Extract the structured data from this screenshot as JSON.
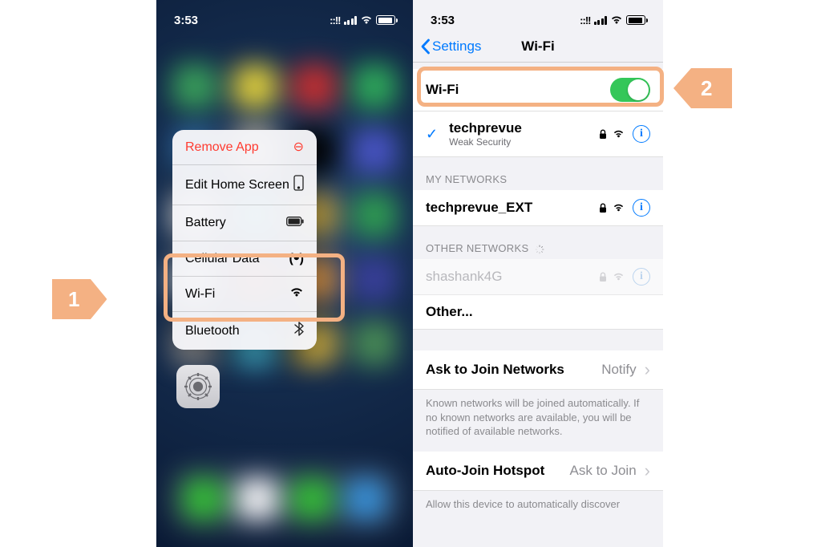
{
  "status_time": "3:53",
  "left": {
    "menu": {
      "remove": "Remove App",
      "edit_home": "Edit Home Screen",
      "battery": "Battery",
      "cellular": "Cellular Data",
      "wifi": "Wi-Fi",
      "bluetooth": "Bluetooth"
    }
  },
  "right": {
    "back": "Settings",
    "title": "Wi-Fi",
    "wifi_label": "Wi-Fi",
    "connected": {
      "ssid": "techprevue",
      "security": "Weak Security"
    },
    "my_networks_header": "MY NETWORKS",
    "my_networks": [
      {
        "ssid": "techprevue_EXT"
      }
    ],
    "other_networks_header": "OTHER NETWORKS",
    "other_networks": [
      {
        "ssid": "shashank4G"
      }
    ],
    "other_label": "Other...",
    "ask_join": {
      "label": "Ask to Join Networks",
      "value": "Notify"
    },
    "ask_join_footer": "Known networks will be joined automatically. If no known networks are available, you will be notified of available networks.",
    "auto_hotspot": {
      "label": "Auto-Join Hotspot",
      "value": "Ask to Join"
    },
    "auto_hotspot_footer": "Allow this device to automatically discover"
  },
  "callouts": {
    "one": "1",
    "two": "2"
  },
  "colors": {
    "accent": "#f4b183",
    "ios_blue": "#007aff",
    "ios_green": "#34c759"
  }
}
